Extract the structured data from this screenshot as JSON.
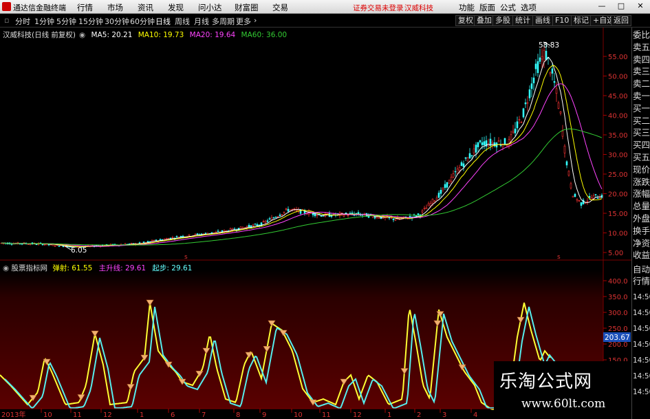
{
  "menubar": {
    "app_title": "通达信金融终端",
    "items": [
      "行情",
      "市场",
      "资讯",
      "发现",
      "问小达",
      "财富圈",
      "交易"
    ],
    "notice": "证券交易未登录",
    "stock_name": "汉威科技",
    "right_items": [
      "功能",
      "版面",
      "公式",
      "选项"
    ]
  },
  "toolbar": {
    "periods": [
      "分时",
      "1分钟",
      "5分钟",
      "15分钟",
      "30分钟",
      "60分钟",
      "日线",
      "周线",
      "月线",
      "多周期",
      "更多"
    ],
    "right_buttons": [
      "复权",
      "叠加",
      "多股",
      "统计",
      "画线",
      "F10",
      "标记",
      "+自选",
      "返回"
    ]
  },
  "main_chart": {
    "title": "汉威科技(日线 前复权)",
    "ma": [
      {
        "label": "MA5: 20.21",
        "color": "#ffffff"
      },
      {
        "label": "MA10: 19.73",
        "color": "#ffff00"
      },
      {
        "label": "MA20: 19.64",
        "color": "#ff44ff"
      },
      {
        "label": "MA60: 36.00",
        "color": "#33cc33"
      }
    ],
    "high_label": "58.83",
    "low_label": "6.05",
    "y_ticks": [
      "55.00",
      "50.00",
      "45.00",
      "40.00",
      "35.00",
      "30.00",
      "25.00",
      "20.00",
      "15.00",
      "10.00",
      "5.00"
    ]
  },
  "indicator": {
    "name": "股票指标网",
    "params": [
      {
        "label": "弹射: 61.55",
        "color": "#ffff00"
      },
      {
        "label": "主升线: 29.61",
        "color": "#ff44ff"
      },
      {
        "label": "起步: 29.61",
        "color": "#66ffff"
      }
    ],
    "y_ticks": [
      "400.0",
      "350.0",
      "300.0",
      "250.0",
      "200.0",
      "150.0"
    ],
    "current_value": "203.67"
  },
  "x_axis": {
    "year_label": "2013年",
    "months": [
      "10",
      "11",
      "12",
      "1",
      "6",
      "7",
      "8",
      "9",
      "10",
      "11",
      "12",
      "1",
      "2",
      "3",
      "4"
    ]
  },
  "right_panel": {
    "labels": [
      "委比",
      "卖五",
      "卖四",
      "卖三",
      "卖二",
      "卖一",
      "买一",
      "买二",
      "买三",
      "买四",
      "买五",
      "现价",
      "涨跌",
      "涨幅",
      "总量",
      "外盘",
      "换手",
      "净资",
      "收益"
    ],
    "bottom_label": "自动",
    "bottom_sub": "行情",
    "times": [
      "14:50",
      "14:50",
      "14:50",
      "14:50",
      "14:50",
      "14:50",
      "14:50"
    ]
  },
  "watermark": {
    "title": "乐淘公式网",
    "url": "www.60lt.com"
  },
  "chart_data": {
    "type": "line",
    "price_series_note": "",
    "price_range": [
      5,
      59
    ]
  }
}
